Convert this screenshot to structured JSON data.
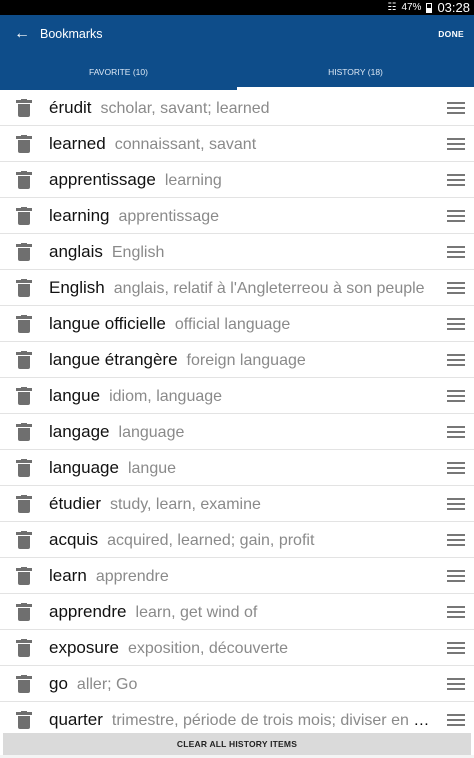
{
  "status_bar": {
    "battery": "47%",
    "time": "03:28"
  },
  "header": {
    "title": "Bookmarks",
    "done_label": "DONE"
  },
  "tabs": [
    {
      "label": "FAVORITE (10)",
      "selected": false
    },
    {
      "label": "HISTORY (18)",
      "selected": true
    }
  ],
  "history": [
    {
      "term": "érudit",
      "definition": "scholar, savant; learned"
    },
    {
      "term": "learned",
      "definition": "connaissant, savant"
    },
    {
      "term": "apprentissage",
      "definition": "learning"
    },
    {
      "term": "learning",
      "definition": "apprentissage"
    },
    {
      "term": "anglais",
      "definition": "English"
    },
    {
      "term": "English",
      "definition": "anglais, relatif à l'Angleterreou à son peuple"
    },
    {
      "term": "langue officielle",
      "definition": "official language"
    },
    {
      "term": "langue étrangère",
      "definition": "foreign language"
    },
    {
      "term": "langue",
      "definition": "idiom, language"
    },
    {
      "term": "langage",
      "definition": "language"
    },
    {
      "term": "language",
      "definition": "langue"
    },
    {
      "term": "étudier",
      "definition": "study, learn, examine"
    },
    {
      "term": "acquis",
      "definition": "acquired, learned; gain, profit"
    },
    {
      "term": "learn",
      "definition": "apprendre"
    },
    {
      "term": "apprendre",
      "definition": "learn, get wind of"
    },
    {
      "term": "exposure",
      "definition": "exposition, découverte"
    },
    {
      "term": "go",
      "definition": "aller; Go"
    },
    {
      "term": "quarter",
      "definition": "trimestre, période de trois mois; diviser en quatre"
    }
  ],
  "footer": {
    "clear_label": "CLEAR ALL HISTORY ITEMS"
  },
  "colors": {
    "app_bar": "#0e4d8a",
    "tab_indicator": "#ffffff",
    "icon_gray": "#6f6f6f"
  }
}
